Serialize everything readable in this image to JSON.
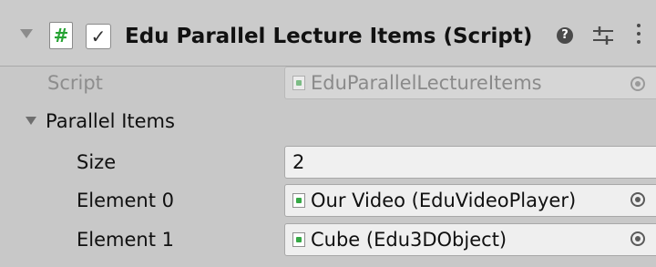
{
  "component": {
    "title": "Edu Parallel Lecture Items (Script)",
    "enabled": true,
    "enabled_glyph": "✓",
    "script_icon_glyph": "#",
    "help_glyph": "?",
    "icons": [
      "foldout-arrow-icon",
      "script-icon",
      "checkmark-icon",
      "help-icon",
      "presets-icon",
      "more-options-icon"
    ],
    "colors": {
      "background": "#c8c8c8",
      "script_icon": "#27a334",
      "disabled_text": "#8d8d8d"
    }
  },
  "properties": {
    "script": {
      "label": "Script",
      "value": "EduParallelLectureItems",
      "disabled": true
    },
    "parallel_items": {
      "label": "Parallel Items",
      "expanded": true,
      "size": {
        "label": "Size",
        "value": "2"
      },
      "elements": [
        {
          "label": "Element 0",
          "value": "Our Video (EduVideoPlayer)"
        },
        {
          "label": "Element 1",
          "value": "Cube (Edu3DObject)"
        }
      ]
    }
  }
}
